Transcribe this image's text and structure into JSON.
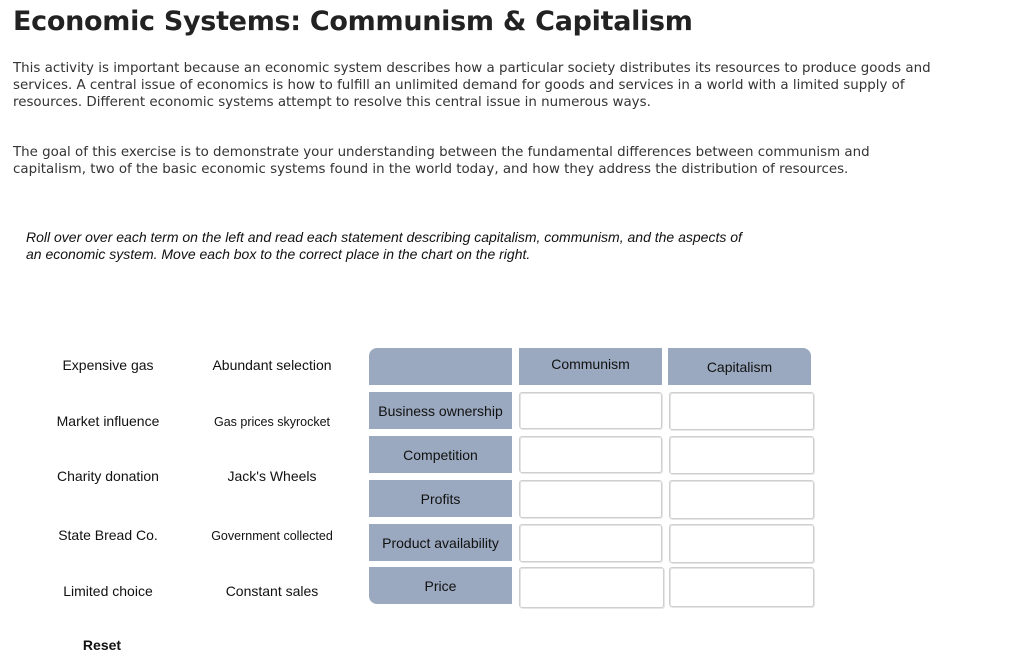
{
  "title": "Economic Systems: Communism & Capitalism",
  "intro_paragraph": "This activity is important because an economic system describes how a particular society distributes its resources to produce goods and services. A central issue of economics is how to fulfill an unlimited demand for goods and services in a world with a limited supply of resources. Different economic systems attempt to resolve this central issue in numerous ways.",
  "goal_paragraph": "The goal of this exercise is to demonstrate your understanding between the fundamental differences between communism and capitalism, two of the basic economic systems found in the world today, and how they address the distribution of resources.",
  "instructions": "Roll over over each term on the left and read each statement describing capitalism, communism, and the aspects of an economic system. Move each box to the correct place in the chart on the right.",
  "terms": [
    {
      "label": "Expensive gas"
    },
    {
      "label": "Abundant selection"
    },
    {
      "label": "Market influence"
    },
    {
      "label": "Gas prices skyrocket"
    },
    {
      "label": "Charity donation"
    },
    {
      "label": "Jack's Wheels"
    },
    {
      "label": "State Bread Co."
    },
    {
      "label": "Government collected"
    },
    {
      "label": "Limited choice"
    },
    {
      "label": "Constant sales"
    }
  ],
  "reset_label": "Reset",
  "chart": {
    "columns": [
      "",
      "Communism",
      "Capitalism"
    ],
    "rows": [
      "Business ownership",
      "Competition",
      "Profits",
      "Product availability",
      "Price"
    ]
  },
  "colors": {
    "header_bg": "#9aa9bf"
  }
}
